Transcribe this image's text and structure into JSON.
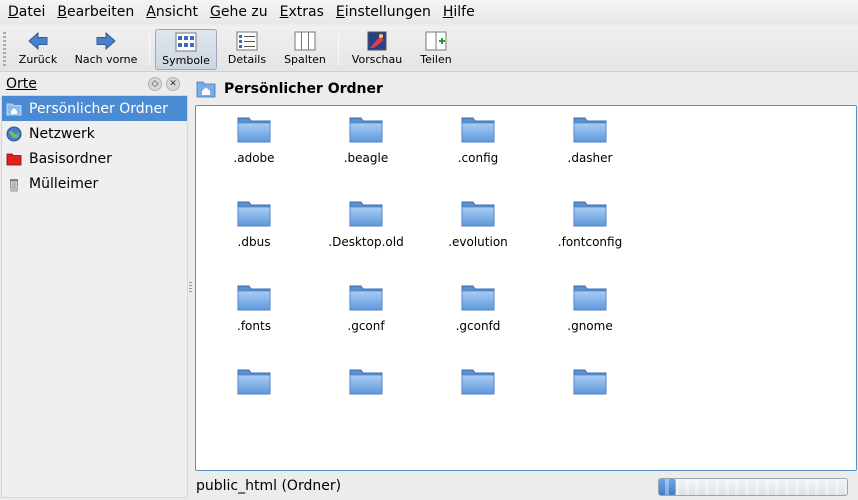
{
  "menu": {
    "items": [
      {
        "acc": "D",
        "rest": "atei"
      },
      {
        "acc": "B",
        "rest": "earbeiten"
      },
      {
        "acc": "A",
        "rest": "nsicht"
      },
      {
        "acc": "G",
        "rest": "ehe zu"
      },
      {
        "acc": "E",
        "rest": "xtras"
      },
      {
        "acc": "E",
        "rest": "instellungen"
      },
      {
        "acc": "H",
        "rest": "ilfe"
      }
    ]
  },
  "toolbar": {
    "back_label": "Zurück",
    "forward_label": "Nach vorne",
    "icons_label": "Symbole",
    "details_label": "Details",
    "columns_label": "Spalten",
    "preview_label": "Vorschau",
    "share_label": "Teilen"
  },
  "places": {
    "title": "Orte",
    "items": [
      {
        "label": "Persönlicher Ordner",
        "icon": "home-folder-icon",
        "selected": true
      },
      {
        "label": "Netzwerk",
        "icon": "network-globe-icon"
      },
      {
        "label": "Basisordner",
        "icon": "root-folder-icon"
      },
      {
        "label": "Mülleimer",
        "icon": "trash-icon"
      }
    ]
  },
  "location": {
    "title": "Persönlicher Ordner"
  },
  "files": [
    [
      ".adobe",
      ".beagle",
      ".config",
      ".dasher"
    ],
    [
      ".dbus",
      ".Desktop.old",
      ".evolution",
      ".fontconfig"
    ],
    [
      ".fonts",
      ".gconf",
      ".gconfd",
      ".gnome"
    ],
    [
      "",
      "",
      "",
      ""
    ]
  ],
  "status": {
    "text": "public_html (Ordner)",
    "progress_fraction": 0.09
  },
  "colors": {
    "selection": "#4a8bd3",
    "folder": "#79aee8",
    "view_border": "#5b8fc9"
  }
}
